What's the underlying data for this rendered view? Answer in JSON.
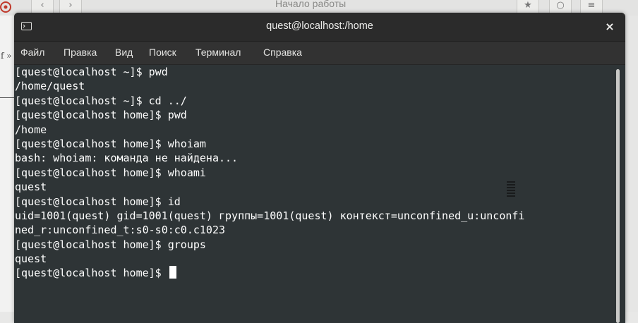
{
  "browser": {
    "title": "Начало работы",
    "side_glyph": "f »"
  },
  "window": {
    "title": "quest@localhost:/home",
    "close_label": "×"
  },
  "menu": {
    "items": [
      "Файл",
      "Правка",
      "Вид",
      "Поиск",
      "Терминал",
      "Справка"
    ]
  },
  "terminal": {
    "lines": [
      "[quest@localhost ~]$ pwd",
      "/home/quest",
      "[quest@localhost ~]$ cd ../",
      "[quest@localhost home]$ pwd",
      "/home",
      "[quest@localhost home]$ whoiam",
      "bash: whoiam: команда не найдена...",
      "[quest@localhost home]$ whoami",
      "quest",
      "[quest@localhost home]$ id",
      "uid=1001(quest) gid=1001(quest) группы=1001(quest) контекст=unconfined_u:unconfi",
      "ned_r:unconfined_t:s0-s0:c0.c1023",
      "[quest@localhost home]$ groups",
      "quest",
      "[quest@localhost home]$ "
    ]
  },
  "colors": {
    "terminal_bg": "#2e3436",
    "terminal_fg": "#ffffff",
    "titlebar_bg": "#2b2b2b",
    "menubar_bg": "#323232"
  },
  "icons": {
    "window_icon": "terminal-icon",
    "close": "close-icon",
    "browser_logo": "browser-logo-icon",
    "pointer": "text-cursor-icon"
  }
}
